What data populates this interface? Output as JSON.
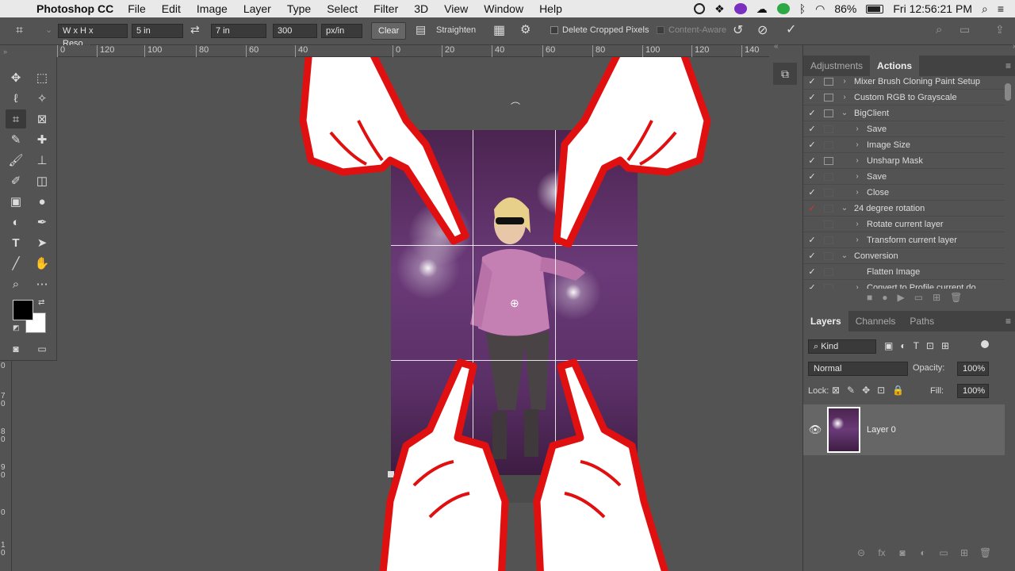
{
  "menubar": {
    "app_name": "Photoshop CC",
    "items": [
      "File",
      "Edit",
      "Image",
      "Layer",
      "Type",
      "Select",
      "Filter",
      "3D",
      "View",
      "Window",
      "Help"
    ],
    "battery": "86%",
    "clock": "Fri 12:56:21 PM"
  },
  "options": {
    "preset": "W x H x Reso...",
    "width": "5 in",
    "height": "7 in",
    "resolution": "300",
    "res_unit": "px/in",
    "clear_label": "Clear",
    "straighten_label": "Straighten",
    "delete_cropped_label": "Delete Cropped Pixels",
    "content_aware_label": "Content-Aware"
  },
  "ruler": {
    "h_ticks": [
      "0",
      "120",
      "100",
      "80",
      "60",
      "40",
      "0",
      "20",
      "40",
      "60",
      "80",
      "100",
      "120",
      "140"
    ],
    "v_ticks": [
      "0",
      "7 0",
      "8 0",
      "9 0",
      "0",
      "1 0"
    ]
  },
  "panels": {
    "top_tabs": [
      "Adjustments",
      "Actions"
    ],
    "actions": [
      {
        "label": "Mixer Brush Cloning Paint Setup",
        "checked": true,
        "dialog": true,
        "indent": 0,
        "twist": "›"
      },
      {
        "label": "Custom RGB to Grayscale",
        "checked": true,
        "dialog": true,
        "indent": 0,
        "twist": "›"
      },
      {
        "label": "BigClient",
        "checked": true,
        "dialog": true,
        "indent": 0,
        "twist": "⌄"
      },
      {
        "label": "Save",
        "checked": true,
        "dialog": false,
        "indent": 1,
        "twist": "›"
      },
      {
        "label": "Image Size",
        "checked": true,
        "dialog": false,
        "indent": 1,
        "twist": "›"
      },
      {
        "label": "Unsharp Mask",
        "checked": true,
        "dialog": true,
        "indent": 1,
        "twist": "›"
      },
      {
        "label": "Save",
        "checked": true,
        "dialog": false,
        "indent": 1,
        "twist": "›"
      },
      {
        "label": "Close",
        "checked": true,
        "dialog": false,
        "indent": 1,
        "twist": "›"
      },
      {
        "label": "24 degree rotation",
        "checked": true,
        "dialog": false,
        "indent": 0,
        "twist": "⌄",
        "red": true
      },
      {
        "label": "Rotate current layer",
        "checked": false,
        "dialog": false,
        "indent": 1,
        "twist": "›"
      },
      {
        "label": "Transform current layer",
        "checked": true,
        "dialog": false,
        "indent": 1,
        "twist": "›"
      },
      {
        "label": "Conversion",
        "checked": true,
        "dialog": false,
        "indent": 0,
        "twist": "⌄"
      },
      {
        "label": "Flatten Image",
        "checked": true,
        "dialog": false,
        "indent": 1,
        "twist": ""
      },
      {
        "label": "Convert to Profile current do...",
        "checked": true,
        "dialog": false,
        "indent": 1,
        "twist": "›"
      }
    ],
    "layer_tabs": [
      "Layers",
      "Channels",
      "Paths"
    ],
    "kind_label": "Kind",
    "blend_mode": "Normal",
    "opacity_label": "Opacity:",
    "opacity_value": "100%",
    "lock_label": "Lock:",
    "fill_label": "Fill:",
    "fill_value": "100%",
    "layer_name": "Layer 0"
  }
}
